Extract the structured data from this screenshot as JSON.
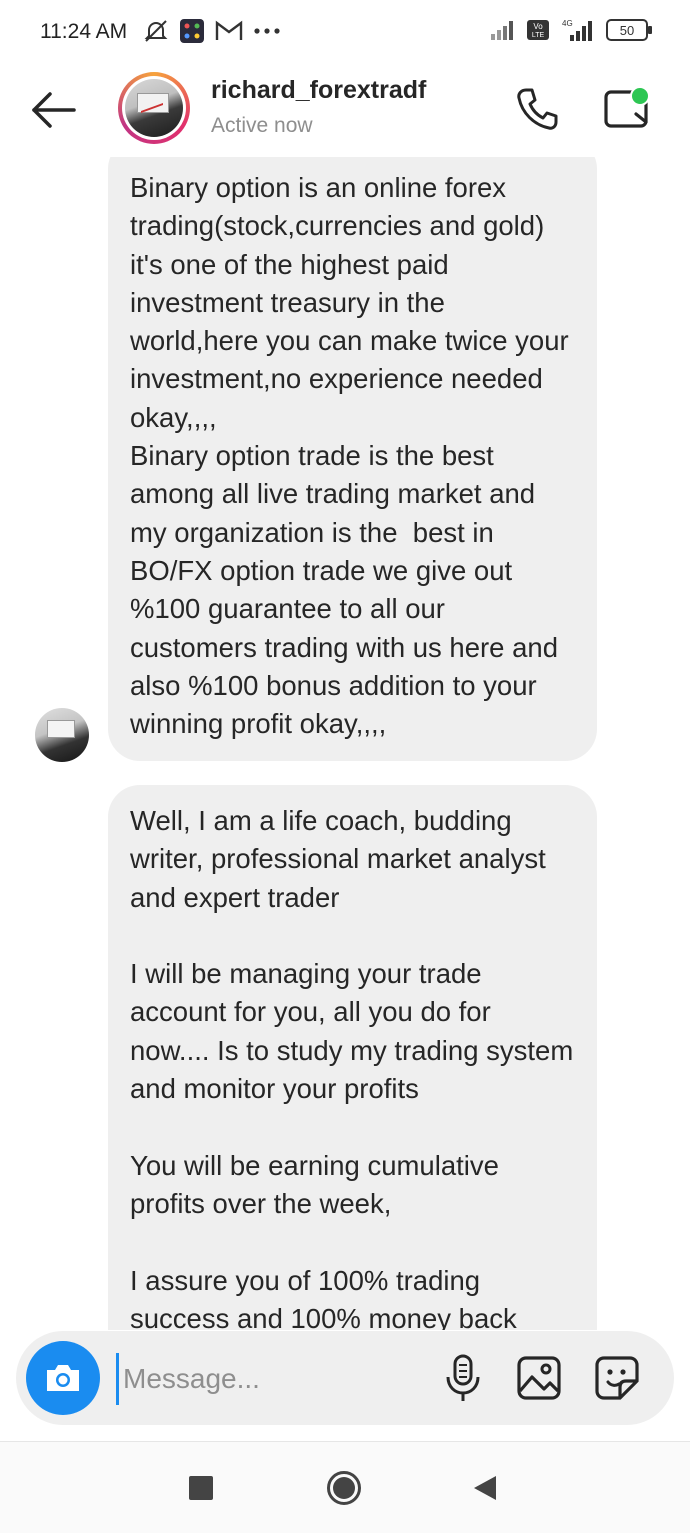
{
  "status_bar": {
    "time": "11:24 AM",
    "left_icons": [
      "muted-alarm-icon",
      "app-grid-icon",
      "gmail-icon",
      "more-dots-icon"
    ],
    "network_label": "4G",
    "volte_label": "Vo LTE",
    "battery": "50"
  },
  "header": {
    "username": "richard_forextradf",
    "status": "Active now",
    "icons": [
      "back-arrow-icon",
      "phone-icon",
      "video-camera-icon"
    ]
  },
  "messages": [
    {
      "sender": "richard_forextradf",
      "text": "Binary option is an online forex trading(stock,currencies and gold) it's one of the highest paid investment treasury in the world,here you can make twice your investment,no experience needed okay,,,,\nBinary option trade is the best among all live trading market and my organization is the  best in BO/FX option trade we give out %100 guarantee to all our customers trading with us here and also %100 bonus addition to your winning profit okay,,,,"
    },
    {
      "sender": "richard_forextradf",
      "text": "Well, I am a life coach, budding writer, professional market analyst and expert trader\n\nI will be managing your trade account for you, all you do for now.... Is to study my trading system and monitor your profits\n\nYou will be earning cumulative profits over the week,\n\nI assure you of 100% trading success and 100% money back"
    }
  ],
  "composer": {
    "placeholder": "Message...",
    "icons": [
      "camera-icon",
      "microphone-icon",
      "gallery-icon",
      "sticker-icon"
    ]
  },
  "nav_bar": {
    "icons": [
      "recents-square-icon",
      "home-circle-icon",
      "back-triangle-icon"
    ]
  },
  "colors": {
    "accent": "#1a8cf0",
    "bubble": "#efefef",
    "online": "#2dc653",
    "muted_text": "#8e8e8e"
  }
}
